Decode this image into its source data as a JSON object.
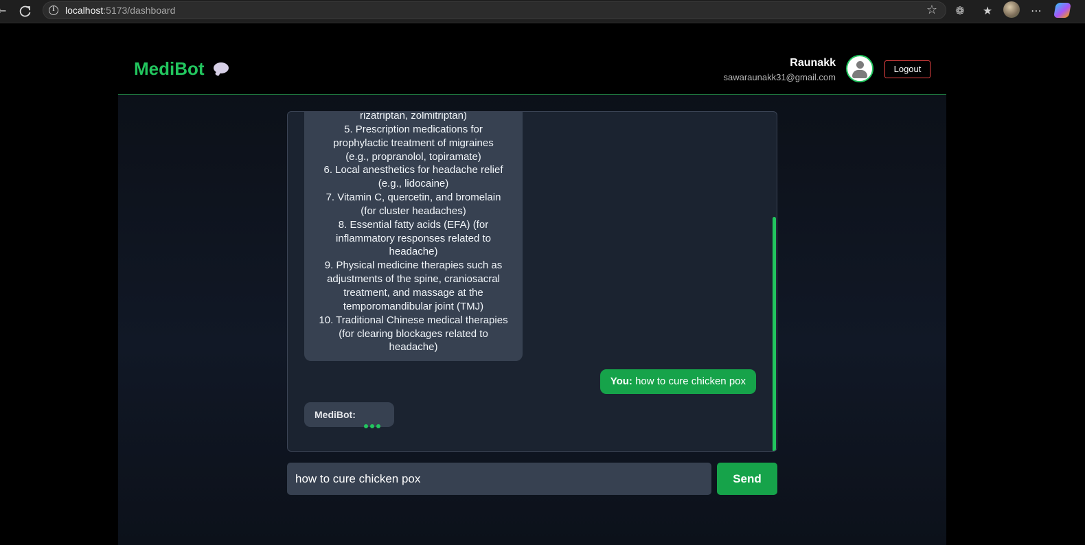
{
  "browser": {
    "url_host": "localhost",
    "url_path": ":5173/dashboard"
  },
  "header": {
    "brand": "MediBot",
    "user_name": "Raunakk",
    "user_email": "sawaraunakk31@gmail.com",
    "logout_label": "Logout"
  },
  "chat": {
    "bot_response_lines": [
      "rizatriptan, zolmitriptan)",
      "5. Prescription medications for",
      "prophylactic treatment of migraines",
      "(e.g., propranolol, topiramate)",
      "6. Local anesthetics for headache relief",
      "(e.g., lidocaine)",
      "7. Vitamin C, quercetin, and bromelain",
      "(for cluster headaches)",
      "8. Essential fatty acids (EFA) (for",
      "inflammatory responses related to",
      "headache)",
      "9. Physical medicine therapies such as",
      "adjustments of the spine, craniosacral",
      "treatment, and massage at the",
      "temporomandibular joint (TMJ)",
      "10. Traditional Chinese medical therapies",
      "(for clearing blockages related to",
      "headache)"
    ],
    "user_prefix": "You:",
    "user_message": "how to cure chicken pox",
    "bot_prefix": "MediBot:"
  },
  "composer": {
    "input_value": "how to cure chicken pox",
    "send_label": "Send"
  },
  "colors": {
    "accent": "#22c55e",
    "bubble_bot": "#374151",
    "bubble_user": "#16a34a",
    "logout_border": "#ef4444"
  }
}
